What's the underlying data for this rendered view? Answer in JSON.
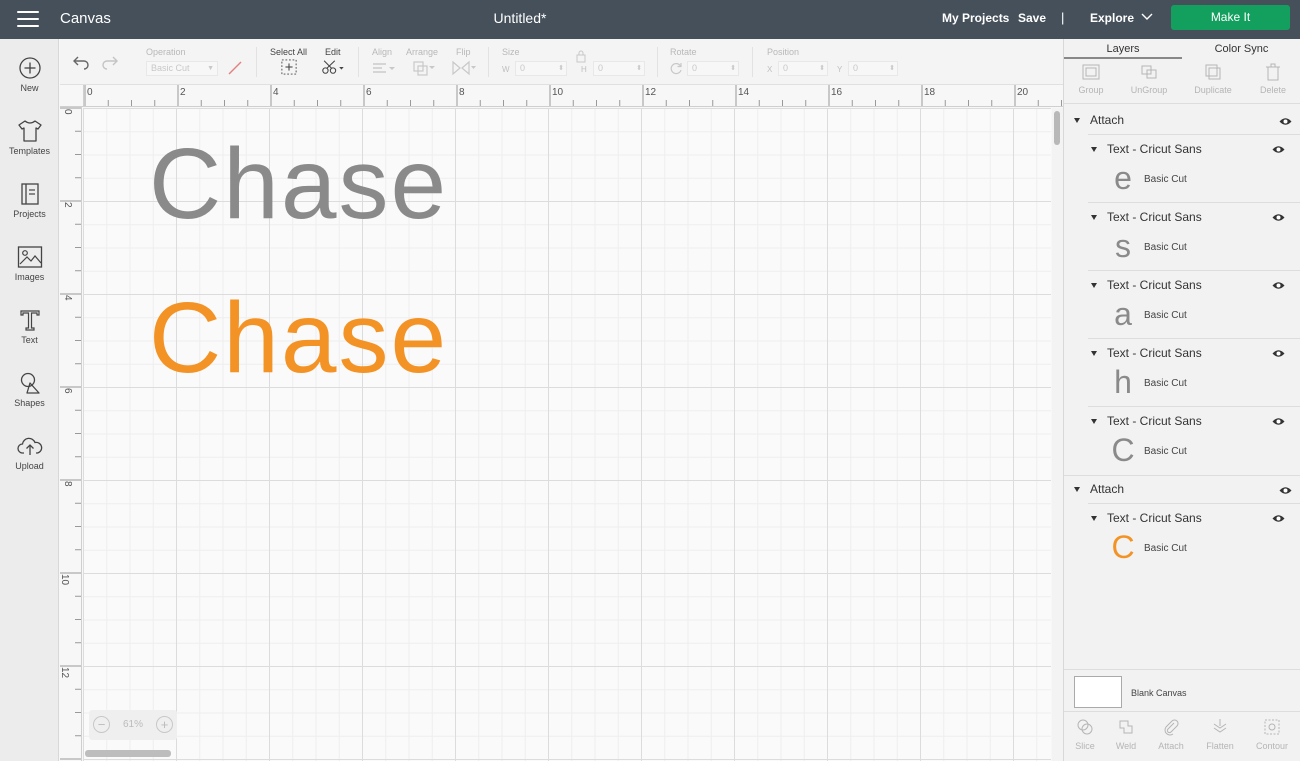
{
  "topbar": {
    "app_title": "Canvas",
    "doc_title": "Untitled*",
    "my_projects": "My Projects",
    "save": "Save",
    "divider": "|",
    "explore": "Explore",
    "make_it": "Make It"
  },
  "leftbar": {
    "items": [
      {
        "label": "New",
        "icon": "plus-circle-icon"
      },
      {
        "label": "Templates",
        "icon": "tshirt-icon"
      },
      {
        "label": "Projects",
        "icon": "notebook-icon"
      },
      {
        "label": "Images",
        "icon": "image-icon"
      },
      {
        "label": "Text",
        "icon": "text-t-icon"
      },
      {
        "label": "Shapes",
        "icon": "shapes-icon"
      },
      {
        "label": "Upload",
        "icon": "cloud-upload-icon"
      }
    ]
  },
  "toolbar": {
    "operation_label": "Operation",
    "operation_value": "Basic Cut",
    "select_all_label": "Select All",
    "edit_label": "Edit",
    "align_label": "Align",
    "arrange_label": "Arrange",
    "flip_label": "Flip",
    "size_label": "Size",
    "w_label": "W",
    "w_value": "0",
    "h_label": "H",
    "h_value": "0",
    "rotate_label": "Rotate",
    "rotate_value": "0",
    "position_label": "Position",
    "x_label": "X",
    "x_value": "0",
    "y_label": "Y",
    "y_value": "0"
  },
  "ruler": {
    "top": [
      "0",
      "2",
      "4",
      "6",
      "8",
      "10",
      "12",
      "14",
      "16",
      "18",
      "20"
    ],
    "left": [
      "0",
      "2",
      "4",
      "6",
      "8",
      "10",
      "12"
    ]
  },
  "canvas": {
    "text_gray": "Chase",
    "text_orange": "Chase",
    "gray_color": "#8a8a8a",
    "orange_color": "#f39325",
    "zoom": "61%",
    "zoom_minus": "−",
    "zoom_plus": "+"
  },
  "panel": {
    "tab_layers": "Layers",
    "tab_color_sync": "Color Sync",
    "actions": [
      "Group",
      "UnGroup",
      "Duplicate",
      "Delete"
    ],
    "group1": {
      "label": "Attach",
      "items": [
        {
          "name": "Text - Cricut Sans",
          "glyph": "e",
          "op": "Basic Cut"
        },
        {
          "name": "Text - Cricut Sans",
          "glyph": "s",
          "op": "Basic Cut"
        },
        {
          "name": "Text - Cricut Sans",
          "glyph": "a",
          "op": "Basic Cut"
        },
        {
          "name": "Text - Cricut Sans",
          "glyph": "h",
          "op": "Basic Cut"
        },
        {
          "name": "Text - Cricut Sans",
          "glyph": "C",
          "op": "Basic Cut"
        }
      ]
    },
    "group2": {
      "label": "Attach",
      "items": [
        {
          "name": "Text - Cricut Sans",
          "glyph": "C",
          "op": "Basic Cut"
        }
      ]
    },
    "blank_canvas": "Blank Canvas",
    "bottom_actions": [
      "Slice",
      "Weld",
      "Attach",
      "Flatten",
      "Contour"
    ]
  }
}
